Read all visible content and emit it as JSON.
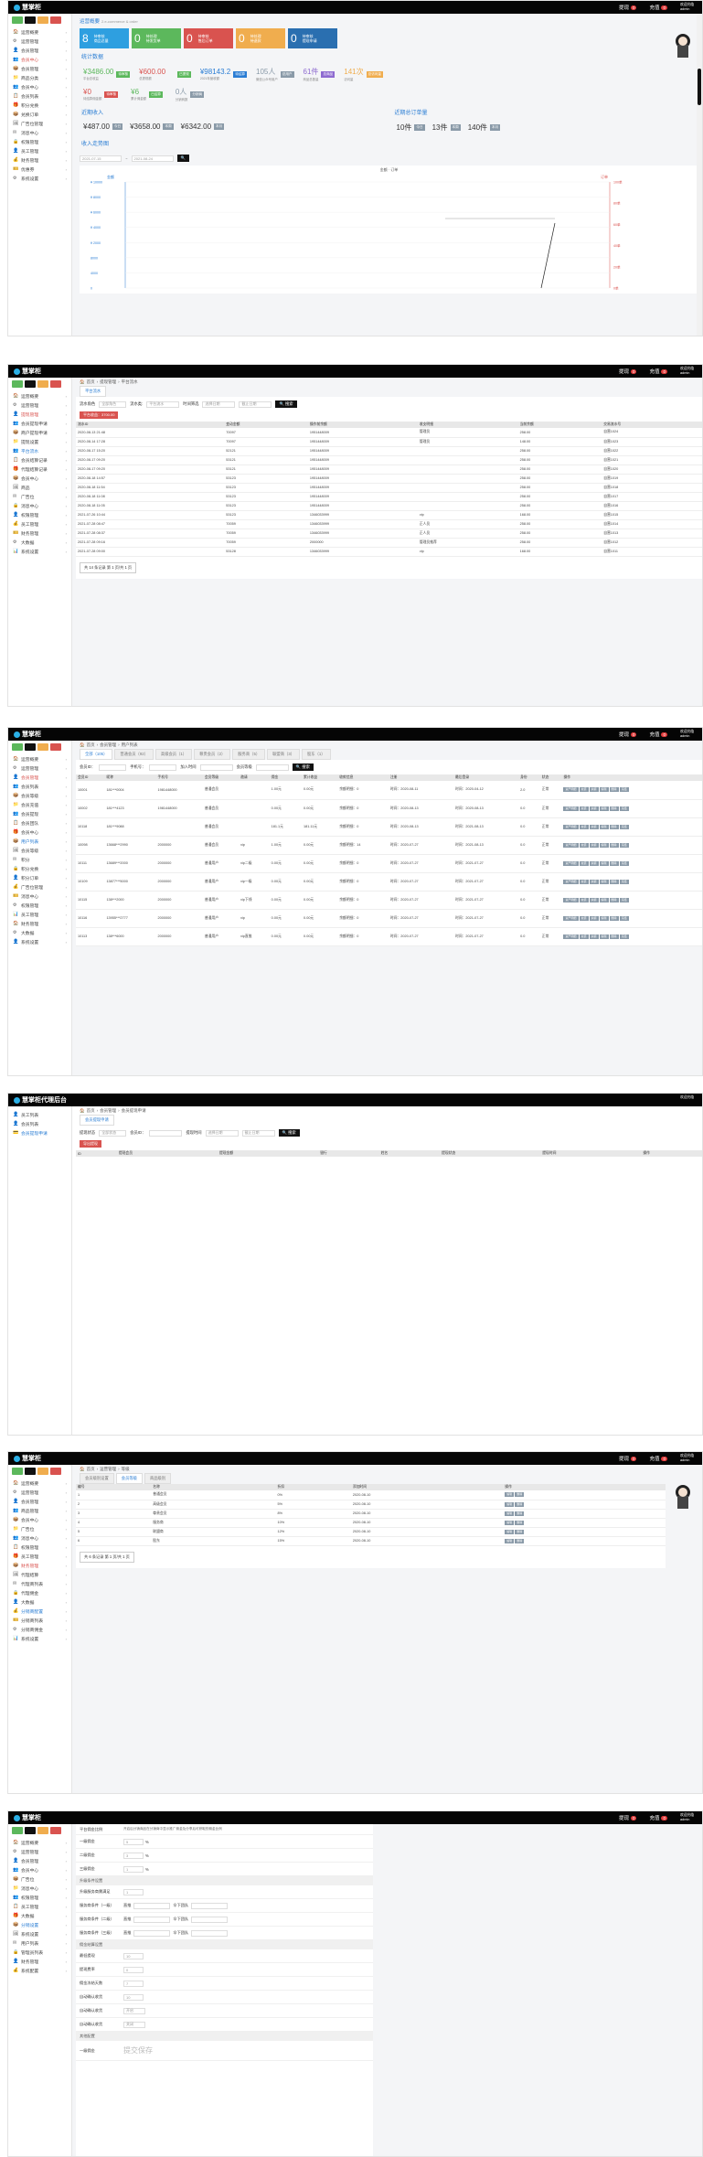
{
  "app": {
    "title": "慧掌柜",
    "notify_label": "提现",
    "notify_count": "0",
    "recharge_label": "充值",
    "recharge_count": "0",
    "user_name": "欢迎光临",
    "user_role": "admin"
  },
  "colors": {
    "green": "#5cb85c",
    "black": "#111111",
    "orange": "#f0ad4e",
    "red": "#d9534f",
    "blue": "#2a7dd4"
  },
  "s1": {
    "bc_title": "运营概要",
    "bc_sub": "2.e-commerce & order",
    "cards": [
      {
        "num": "8",
        "line1": "待审核",
        "line2": "商品总量",
        "color": "#2e9fe0"
      },
      {
        "num": "0",
        "line1": "待处理",
        "line2": "待发货单",
        "color": "#5cb85c"
      },
      {
        "num": "0",
        "line1": "待审核",
        "line2": "售后订单",
        "color": "#d9534f"
      },
      {
        "num": "0",
        "line1": "待处理",
        "line2": "待退款",
        "color": "#f0ad4e"
      },
      {
        "num": "0",
        "line1": "待审核",
        "line2": "提现申请",
        "color": "#2a6fb0"
      }
    ],
    "sec_stats": "统计数据",
    "stats_row1": [
      {
        "v": "¥3486.00",
        "tag": "待审核",
        "tc": "#5cb85c",
        "cap": "平台总收益",
        "vc": "#5cb85c"
      },
      {
        "v": "¥600.00",
        "tag": "",
        "tc": "",
        "cap": "总提现额",
        "vc": "#d9534f"
      },
      {
        "v": "",
        "tag": "已提现",
        "tc": "#5cb85c",
        "cap": "",
        "vc": ""
      },
      {
        "v": "¥98143.2",
        "tag": "待结算",
        "tc": "#2a7dd4",
        "cap": "2021年营收额",
        "vc": "#2a7dd4"
      },
      {
        "v": "105人",
        "tag": "总用户",
        "tc": "#8a9aa8",
        "cap": "微信公众号用户",
        "vc": "#8a9aa8"
      },
      {
        "v": "61件",
        "tag": "总商品",
        "tc": "#8e6bd0",
        "cap": "商品总数量",
        "vc": "#8e6bd0"
      },
      {
        "v": "141次",
        "tag": "总访问量",
        "tc": "#f0ad4e",
        "cap": "访问量",
        "vc": "#f0ad4e"
      }
    ],
    "stats_row2": [
      {
        "v": "¥0",
        "tag": "待审核",
        "tc": "#d9534f",
        "cap": "待结算佣金额",
        "vc": "#d9534f"
      },
      {
        "v": "¥6",
        "tag": "已结算",
        "tc": "#5cb85c",
        "cap": "累计佣金额",
        "vc": "#5cb85c"
      },
      {
        "v": "0人",
        "tag": "分销商",
        "tc": "#8a9aa8",
        "cap": "分销商数",
        "vc": "#8a9aa8"
      }
    ],
    "sec_recent": "近期收入",
    "sec_orders": "近期总订单量",
    "recent_vals": [
      {
        "v": "¥487.00",
        "tag": "今日"
      },
      {
        "v": "¥3658.00",
        "tag": "本周"
      },
      {
        "v": "¥6342.00",
        "tag": "本月"
      }
    ],
    "order_vals": [
      {
        "v": "10件",
        "tag": "今日"
      },
      {
        "v": "13件",
        "tag": "本周"
      },
      {
        "v": "140件",
        "tag": "本月"
      }
    ],
    "sec_chart": "收入走势图",
    "date_from": "2021-07-15",
    "date_to": "2021-08-24",
    "legend": [
      "金额",
      "订单"
    ]
  },
  "chart_data": {
    "type": "line",
    "title": "",
    "xlabel": "",
    "ylabel": "金额",
    "y2label": "订单",
    "left_ticks": [
      "¥ 10000",
      "¥ 8000",
      "¥ 6000",
      "¥ 4000",
      "¥ 2000",
      "8000",
      "4000",
      "0"
    ],
    "right_ticks": [
      "100单",
      "80单",
      "60单",
      "40单",
      "20单",
      "0单"
    ],
    "series": []
  },
  "s2": {
    "bc": [
      "首页",
      "提现管理",
      "平台流水"
    ],
    "tab": "平台流水",
    "f_user": "流水角色",
    "f_user_val": "全部角色",
    "f_type": "流水类:",
    "f_type_val": "平台流水",
    "f_time": "时间筛选",
    "f_time_val": "选择日期",
    "f_end": "截止日期",
    "btn": "搜索",
    "export": "平台收益：3700.00",
    "cols": [
      "流水ID",
      "变动金额",
      "操作前余额",
      "收支明细",
      "当前余额",
      "交易流水号"
    ],
    "rows": [
      [
        "2020-08-13 21:48",
        "70097",
        "1951448009",
        "管理员",
        "258.00",
        "成都交易管理",
        "自营1024"
      ],
      [
        "2020-08-14 17:28",
        "70097",
        "1951448009",
        "管理员",
        "148.00",
        "成都交易管理",
        "自营1023"
      ],
      [
        "2020-08-17 15:20",
        "52121",
        "1951448009",
        "",
        "258.00",
        "成都交易管理",
        "自营1022"
      ],
      [
        "2020-08-17 09:20",
        "53121",
        "1951448009",
        "",
        "258.00",
        "成都交易管理",
        "自营1021"
      ],
      [
        "2020-08-17 09:20",
        "53121",
        "1951448009",
        "",
        "258.00",
        "成都交易管理",
        "自营1020"
      ],
      [
        "2020-08-18 14:57",
        "53123",
        "1951448009",
        "",
        "258.00",
        "成都交易管理",
        "自营1019"
      ],
      [
        "2020-08-18 11:54",
        "53123",
        "1951448009",
        "",
        "258.00",
        "成都交易管理",
        "自营1018"
      ],
      [
        "2020-08-18 11:08",
        "53123",
        "1951448009",
        "",
        "258.00",
        "成都交易管理",
        "自营1017"
      ],
      [
        "2020-08-18 11:05",
        "53123",
        "1951448009",
        "",
        "258.00",
        "成都交易管理",
        "自营1016"
      ],
      [
        "2021-07-26 10:44",
        "53123",
        "1346033999",
        "vip",
        "168.00",
        "成都交易管理",
        "自营1015"
      ],
      [
        "2021-07-28 08:47",
        "70059",
        "1346033999",
        "正人员",
        "258.00",
        "成都交易管理",
        "自营1014"
      ],
      [
        "2021-07-28 08:37",
        "70059",
        "1346033999",
        "正人员",
        "258.00",
        "成都交易管理",
        "自营1013"
      ],
      [
        "2021-07-28 09:16",
        "70059",
        "2000000",
        "管理员推荐",
        "258.00",
        "成都交易管理",
        "自营1012"
      ],
      [
        "2021-07-28 09:00",
        "53128",
        "1346033999",
        "vip",
        "168.00",
        "成都交易管理",
        "自营1011"
      ]
    ],
    "pager": "共 14 条记录 第 1 页/共 1 页"
  },
  "s3": {
    "bc": [
      "首页",
      "会员管理",
      "用户列表"
    ],
    "tabs": [
      "全部（105）",
      "普通会员（92）",
      "高级会员（1）",
      "尊贵会员（2）",
      "服务商（5）",
      "联盟商（3）",
      "股东（1）"
    ],
    "f_phone": "会员ID：",
    "f_name": "手机号：",
    "f_reg": "加入时间",
    "f_level": "会员等级",
    "btn": "搜索",
    "cols": [
      "会员ID",
      "昵称",
      "手机号",
      "会员等级",
      "邀请",
      "佣金",
      "累计收益",
      "收款信息",
      "注册",
      "最后登录",
      "身份",
      "状态",
      "操作"
    ],
    "rows": [
      [
        "10001",
        "181***0004",
        "1981448000",
        "普通会员",
        "",
        "1.00元",
        "0.00元",
        "余额明细：0",
        "时间：2020-08-11",
        "时间：2020-04-12",
        "2.0",
        "正常"
      ],
      [
        "10002",
        "181***4123",
        "1981448000",
        "普通会员",
        "",
        "0.00元",
        "0.00元",
        "余额明细：0",
        "时间：2020-08-13",
        "时间：2020-08-13",
        "0.0",
        "正常"
      ],
      [
        "10118",
        "181***9088",
        "",
        "普通会员",
        "",
        "181.1元",
        "181.11元",
        "余额明细：0",
        "时间：2020-08-13",
        "时间：2021-08-13",
        "0.0",
        "正常"
      ],
      [
        "10098",
        "13668***2990",
        "2000000",
        "普通会员",
        "vip",
        "1.00元",
        "0.00元",
        "余额明细：14",
        "时间：2020-07-27",
        "时间：2021-08-13",
        "0.0",
        "正常"
      ],
      [
        "10111",
        "13689***2000",
        "2000000",
        "普通用户",
        "vip二级",
        "0.00元",
        "0.00元",
        "余额明细：0",
        "时间：2020-07-27",
        "时间：2021-07-27",
        "0.0",
        "正常"
      ],
      [
        "10109",
        "13877***5000",
        "2000000",
        "普通用户",
        "vip一级",
        "0.00元",
        "0.00元",
        "余额明细：0",
        "时间：2020-07-27",
        "时间：2021-07-27",
        "0.0",
        "正常"
      ],
      [
        "10115",
        "138***2000",
        "2000000",
        "普通用户",
        "vip下线",
        "0.00元",
        "0.00元",
        "余额明细：0",
        "时间：2020-07-27",
        "时间：2021-07-27",
        "0.0",
        "正常"
      ],
      [
        "10116",
        "13955***2777",
        "2000000",
        "普通用户",
        "vip",
        "0.00元",
        "0.00元",
        "余额明细：0",
        "时间：2020-07-27",
        "时间：2021-07-27",
        "0.0",
        "正常"
      ],
      [
        "10113",
        "138***6000",
        "2000000",
        "普通用户",
        "vip直推",
        "0.00元",
        "0.00元",
        "余额明细：0",
        "时间：2020-07-27",
        "时间：2021-07-27",
        "0.0",
        "正常"
      ]
    ],
    "actions": [
      "资产明细",
      "充值",
      "余额",
      "编辑",
      "删除",
      "冻结"
    ]
  },
  "s4": {
    "top_title": "慧掌柜代理后台",
    "user": "欢迎光临",
    "nav": [
      "员工列表",
      "会员列表",
      "会员提现申请"
    ],
    "bc": [
      "首页",
      "会员管理",
      "会员提现申请"
    ],
    "tab": "会员提现申请",
    "f_status": "提现状态",
    "f_status_val": "全部状态",
    "f_member": "会员ID：",
    "f_time": "提现时间",
    "f_time_val": "选择日期",
    "f_end": "截止日期",
    "btn": "搜索",
    "export": "导出提现",
    "cols": [
      "ID",
      "提现会员",
      "提现金额",
      "银行",
      "姓名",
      "提现状态",
      "提现时间",
      "操作"
    ]
  },
  "s5": {
    "bc": [
      "首页",
      "运营管理",
      "等级"
    ],
    "tabs": [
      "会员级别设置",
      "会员等级",
      "商品级别"
    ],
    "cols": [
      "编号",
      "名称",
      "折扣",
      "添加时间",
      "操作"
    ],
    "rows": [
      [
        "1",
        "普通会员",
        "0%",
        "2020-08-10"
      ],
      [
        "2",
        "高级会员",
        "5%",
        "2020-08-10"
      ],
      [
        "3",
        "尊贵会员",
        "8%",
        "2020-08-10"
      ],
      [
        "4",
        "服务商",
        "10%",
        "2020-08-10"
      ],
      [
        "5",
        "联盟商",
        "12%",
        "2020-08-10"
      ],
      [
        "6",
        "股东",
        "15%",
        "2020-08-10"
      ]
    ],
    "row_actions": [
      "编辑",
      "删除"
    ],
    "pager": "共 6 条记录 第 1 页/共 1 页"
  },
  "s6": {
    "rows": [
      {
        "label": "平台佣金比例",
        "value": "0",
        "unit": "%"
      },
      {
        "label": "一级佣金",
        "value": "5",
        "unit": "%"
      },
      {
        "label": "二级佣金",
        "value": "3",
        "unit": "%"
      },
      {
        "label": "三级佣金",
        "value": "1",
        "unit": "%"
      }
    ],
    "notice": "开启后分销商品在分销商中显示推广佣金及分享后可获取的佣金比例",
    "sec1": "升级条件设置",
    "sec2": "佣金结算设置",
    "lvl": "升级服务商需满足",
    "lvl_rows": [
      "服务商条件（一级）",
      "服务商条件（二级）",
      "服务商条件（三级）"
    ],
    "lvl_a": "直推",
    "lvl_b": "个",
    "lvl_c": "伞下团队",
    "lvl_d": "人",
    "extra_rows": [
      "最低提现",
      "提现费率",
      "佣金冻结天数",
      "自动确认收货"
    ],
    "extra_vals": [
      "10",
      "0",
      "7",
      "10"
    ],
    "sel1": "开启",
    "sel2": "关闭",
    "sec3": "其他配置",
    "save": "提交保存"
  },
  "sidebar": {
    "s1": [
      "运营概要",
      "运营管理",
      "会员管理",
      "会员中心",
      "会员管理",
      "商品分类",
      "会员中心",
      "会员列表",
      "积分兑换",
      "兑换订单",
      "广告位管理",
      "消息中心",
      "权限管理",
      "员工管理",
      "财务管理",
      "优惠券",
      "系统设置"
    ],
    "s2": [
      "运营概要",
      "运营管理",
      "提现管理",
      "会员提现申请",
      "商户提现申请",
      "提现设置",
      "平台流水",
      "会员结算记录",
      "代理结算记录",
      "会员中心",
      "商品",
      "广告位",
      "消息中心",
      "权限管理",
      "员工管理",
      "财务管理",
      "大数据",
      "系统设置"
    ],
    "s3": [
      "运营概要",
      "运营管理",
      "会员管理",
      "会员列表",
      "会员等级",
      "会员充值",
      "会员提现",
      "会员团队",
      "会员中心",
      "用户列表",
      "会员等级",
      "积分",
      "积分兑换",
      "积分订单",
      "广告位管理",
      "消息中心",
      "权限管理",
      "员工管理",
      "财务管理",
      "大数据",
      "系统设置"
    ],
    "s5": [
      "运营概要",
      "运营管理",
      "会员管理",
      "商品管理",
      "会员中心",
      "广告位",
      "消息中心",
      "权限管理",
      "员工管理",
      "财务管理",
      "代理结算",
      "代理商列表",
      "代理佣金",
      "大数据",
      "分销商配置",
      "分销商列表",
      "分销商佣金",
      "系统设置"
    ],
    "s6": [
      "运营概要",
      "运营管理",
      "会员管理",
      "会员中心",
      "广告位",
      "消息中心",
      "权限管理",
      "员工管理",
      "大数据",
      "分销设置",
      "系统设置",
      "用户列表",
      "管理员列表",
      "财务管理",
      "系统配置"
    ]
  }
}
